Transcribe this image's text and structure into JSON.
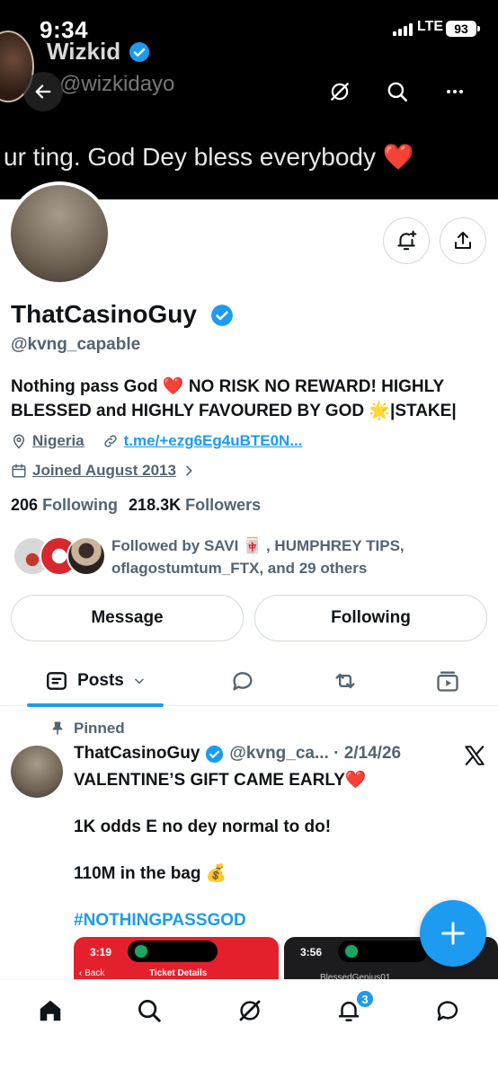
{
  "status_bar": {
    "time": "9:34",
    "network": "LTE",
    "battery": "93"
  },
  "banner": {
    "name": "Wizkid",
    "handle": "@wizkidayo",
    "tweet_text": "ur ting. God Dey bless everybody ❤️"
  },
  "profile": {
    "display_name": "ThatCasinoGuy",
    "handle": "@kvng_capable",
    "bio": "Nothing pass God ❤️ NO RISK NO REWARD! HIGHLY BLESSED and HIGHLY FAVOURED BY GOD 🌟|STAKE|",
    "location": "Nigeria",
    "website": "t.me/+ezg6Eg4uBTE0N...",
    "joined": "Joined August 2013",
    "following_count": "206",
    "following_label": "Following",
    "followers_count": "218.3K",
    "followers_label": "Followers",
    "followed_by": "Followed by SAVI 🀄 , HUMPHREY TIPS, oflagostumtum_FTX, and 29 others"
  },
  "actions": {
    "message": "Message",
    "following": "Following"
  },
  "tabs": {
    "posts": "Posts"
  },
  "pinned_tweet": {
    "pinned_label": "Pinned",
    "author": "ThatCasinoGuy",
    "handle_date": "@kvng_ca... · 2/14/26",
    "lines": [
      "VALENTINE’S GIFT CAME EARLY❤️",
      "1K odds E no dey normal to do!",
      "110M in the bag 💰"
    ],
    "hashtag": "#NOTHINGPASSGOD",
    "images": [
      {
        "time": "3:19",
        "back": "‹ Back",
        "title": "Ticket Details"
      },
      {
        "time": "3:56",
        "user": "BlessedGenius01"
      }
    ]
  },
  "bottom_nav": {
    "notification_badge": "3"
  },
  "colors": {
    "accent": "#1d9bf0",
    "text": "#0f1419",
    "secondary": "#536471",
    "border": "#cfd9de"
  }
}
